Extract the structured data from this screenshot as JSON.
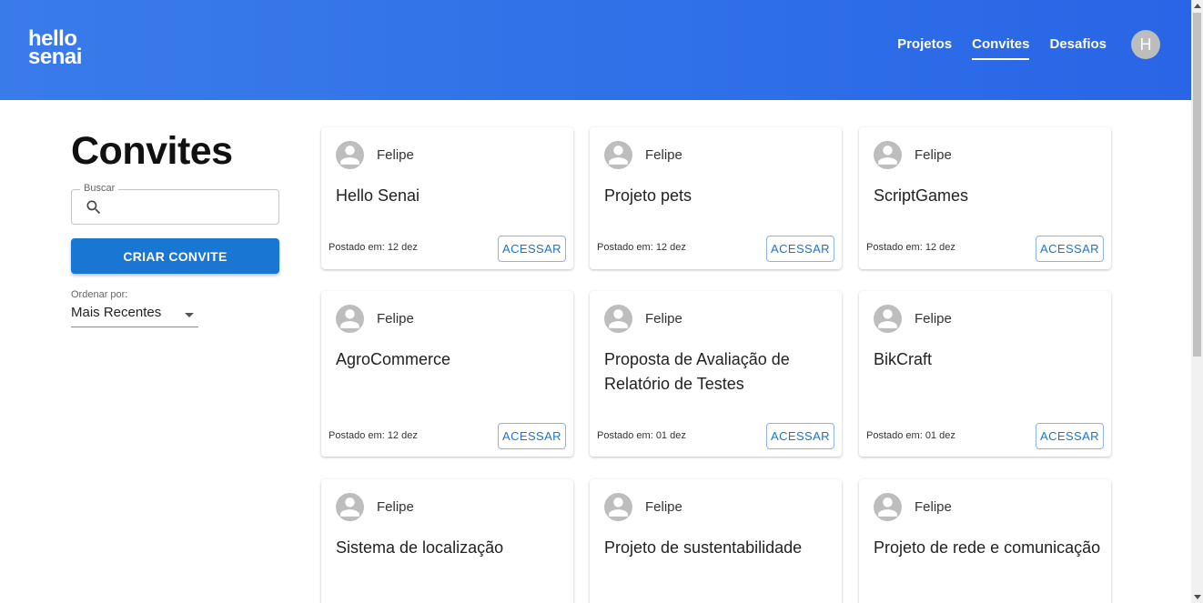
{
  "header": {
    "logo_line1": "hello",
    "logo_line2": "senai",
    "nav": [
      "Projetos",
      "Convites",
      "Desafios"
    ],
    "active_nav": "Convites",
    "user_initial": "H"
  },
  "sidebar": {
    "title": "Convites",
    "search_label": "Buscar",
    "search_value": "",
    "create_button": "CRIAR CONVITE",
    "sort_label": "Ordenar por:",
    "sort_value": "Mais Recentes"
  },
  "cards": [
    {
      "author": "Felipe",
      "title": "Hello Senai",
      "date": "Postado em: 12 dez",
      "button": "ACESSAR"
    },
    {
      "author": "Felipe",
      "title": "Projeto pets",
      "date": "Postado em: 12 dez",
      "button": "ACESSAR"
    },
    {
      "author": "Felipe",
      "title": "ScriptGames",
      "date": "Postado em: 12 dez",
      "button": "ACESSAR"
    },
    {
      "author": "Felipe",
      "title": "AgroCommerce",
      "date": "Postado em: 12 dez",
      "button": "ACESSAR"
    },
    {
      "author": "Felipe",
      "title": "Proposta de Avaliação de Relatório de Testes",
      "date": "Postado em: 01 dez",
      "button": "ACESSAR"
    },
    {
      "author": "Felipe",
      "title": "BikCraft",
      "date": "Postado em: 01 dez",
      "button": "ACESSAR"
    },
    {
      "author": "Felipe",
      "title": "Sistema de localização",
      "date": "",
      "button": ""
    },
    {
      "author": "Felipe",
      "title": "Projeto de sustentabilidade",
      "date": "",
      "button": ""
    },
    {
      "author": "Felipe",
      "title": "Projeto de rede e comunicação",
      "date": "",
      "button": ""
    }
  ],
  "colors": {
    "header_bg": "#2f6fe8",
    "primary_button": "#1976d2",
    "avatar_gray": "#bdbdbd"
  }
}
